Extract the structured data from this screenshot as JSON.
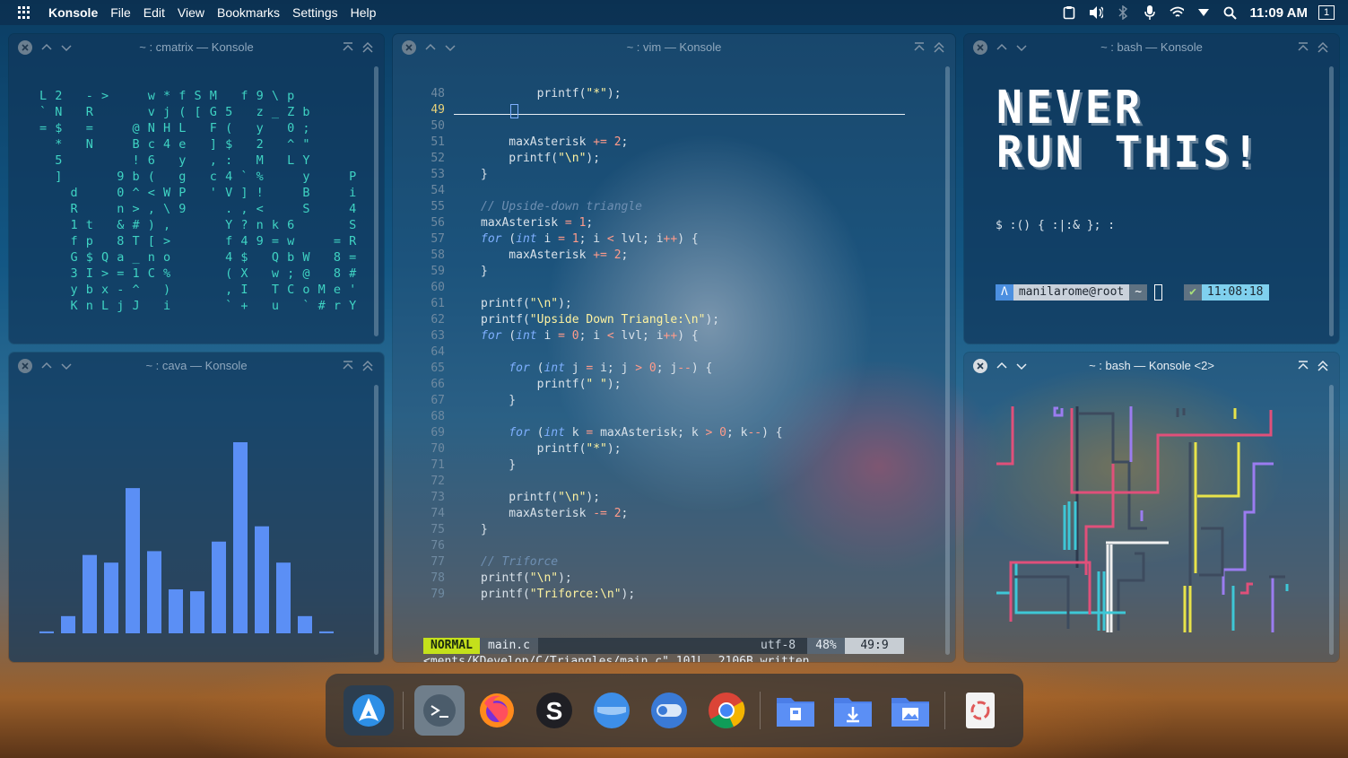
{
  "menubar": {
    "app": "Konsole",
    "items": [
      "File",
      "Edit",
      "View",
      "Bookmarks",
      "Settings",
      "Help"
    ],
    "clock": "11:09 AM",
    "desktop": "1"
  },
  "windows": {
    "cmatrix": {
      "title": "~ : cmatrix — Konsole",
      "lines": [
        "L 2   - >     w * f S M   f 9 \\ p",
        "` N   R       v j ( [ G 5   z _ Z b",
        "= $   =     @ N H L   F (   y   0 ;",
        "  *   N     B c 4 e   ] $   2   ^ \"",
        "  5         ! 6   y   , :   M   L Y",
        "  ]       9 b (   g   c 4 ` %     y     P",
        "    d     0 ^ < W P   ' V ] !     B     i",
        "    R     n > , \\ 9     . , <     S     4",
        "    1 t   & # ) ,       Y ? n k 6       S",
        "    f p   8 T [ >       f 4 9 = w     = R",
        "    G $ Q a _ n o       4 $   Q b W   8 =",
        "    3 I > = 1 C %       ( X   w ; @   8 #",
        "    y b x - ^   )       , I   T C o M e '",
        "    K n L j J   i       ` +   u   ` # r Y"
      ]
    },
    "cava": {
      "title": "~ : cava — Konsole",
      "bars": [
        0.01,
        0.09,
        0.41,
        0.37,
        0.76,
        0.43,
        0.23,
        0.22,
        0.48,
        1.0,
        0.56,
        0.37,
        0.09,
        0.01
      ]
    },
    "vim": {
      "title": "~ : vim — Konsole",
      "lines": [
        {
          "n": "48",
          "html": "        printf(<span class=\"str\">\"*\"</span>);"
        },
        {
          "n": "49",
          "html": "",
          "current": true
        },
        {
          "n": "50",
          "html": ""
        },
        {
          "n": "51",
          "html": "    maxAsterisk <span class=\"op\">+=</span> <span class=\"num\">2</span>;"
        },
        {
          "n": "52",
          "html": "    printf(<span class=\"str\">\"\\n\"</span>);"
        },
        {
          "n": "53",
          "html": "}"
        },
        {
          "n": "54",
          "html": ""
        },
        {
          "n": "55",
          "html": "<span class=\"cm\">// Upside-down triangle</span>"
        },
        {
          "n": "56",
          "html": "maxAsterisk <span class=\"op\">=</span> <span class=\"num\">1</span>;"
        },
        {
          "n": "57",
          "html": "<span class=\"kw\">for</span> (<span class=\"ty\">int</span> i <span class=\"op\">=</span> <span class=\"num\">1</span>; i <span class=\"op\">&lt;</span> lvl; i<span class=\"op\">++</span>) {"
        },
        {
          "n": "58",
          "html": "    maxAsterisk <span class=\"op\">+=</span> <span class=\"num\">2</span>;"
        },
        {
          "n": "59",
          "html": "}"
        },
        {
          "n": "60",
          "html": ""
        },
        {
          "n": "61",
          "html": "printf(<span class=\"str\">\"\\n\"</span>);"
        },
        {
          "n": "62",
          "html": "printf(<span class=\"str\">\"Upside Down Triangle:\\n\"</span>);"
        },
        {
          "n": "63",
          "html": "<span class=\"kw\">for</span> (<span class=\"ty\">int</span> i <span class=\"op\">=</span> <span class=\"num\">0</span>; i <span class=\"op\">&lt;</span> lvl; i<span class=\"op\">++</span>) {"
        },
        {
          "n": "64",
          "html": ""
        },
        {
          "n": "65",
          "html": "    <span class=\"kw\">for</span> (<span class=\"ty\">int</span> j <span class=\"op\">=</span> i; j <span class=\"op\">&gt;</span> <span class=\"num\">0</span>; j<span class=\"op\">--</span>) {"
        },
        {
          "n": "66",
          "html": "        printf(<span class=\"str\">\" \"</span>);"
        },
        {
          "n": "67",
          "html": "    }"
        },
        {
          "n": "68",
          "html": ""
        },
        {
          "n": "69",
          "html": "    <span class=\"kw\">for</span> (<span class=\"ty\">int</span> k <span class=\"op\">=</span> maxAsterisk; k <span class=\"op\">&gt;</span> <span class=\"num\">0</span>; k<span class=\"op\">--</span>) {"
        },
        {
          "n": "70",
          "html": "        printf(<span class=\"str\">\"*\"</span>);"
        },
        {
          "n": "71",
          "html": "    }"
        },
        {
          "n": "72",
          "html": ""
        },
        {
          "n": "73",
          "html": "    printf(<span class=\"str\">\"\\n\"</span>);"
        },
        {
          "n": "74",
          "html": "    maxAsterisk <span class=\"op\">-=</span> <span class=\"num\">2</span>;"
        },
        {
          "n": "75",
          "html": "}"
        },
        {
          "n": "76",
          "html": ""
        },
        {
          "n": "77",
          "html": "<span class=\"cm\">// Triforce</span>"
        },
        {
          "n": "78",
          "html": "printf(<span class=\"str\">\"\\n\"</span>);"
        },
        {
          "n": "79",
          "html": "printf(<span class=\"str\">\"Triforce:\\n\"</span>);"
        }
      ],
      "status": {
        "mode": "NORMAL",
        "file": "main.c",
        "encoding": "utf-8",
        "percent": "48%",
        "position": "49:9"
      },
      "message": "<ments/KDevelop/C/Triangles/main.c\" 101L, 2106B written"
    },
    "bash1": {
      "title": "~ : bash — Konsole",
      "banner_line1": "NEVER",
      "banner_line2": "RUN THIS!",
      "command": "$ :() { :|:& }; :",
      "prompt_user": "manilarome@root",
      "prompt_dir": "~",
      "prompt_check": "✔",
      "prompt_time": "11:08:18"
    },
    "bash2": {
      "title": "~ : bash — Konsole <2>"
    }
  },
  "dock": {
    "apps": [
      "arch-launcher",
      "terminal",
      "firefox",
      "sublime-text",
      "files",
      "settings-toggle",
      "chrome",
      "folder-documents",
      "folder-downloads",
      "folder-pictures",
      "trash"
    ]
  },
  "colors": {
    "matrix": "#3fd3c3",
    "cava": "#5b8ff5",
    "vim_mode": "#c4e01b",
    "prompt_user_bg": "#c9d1db",
    "prompt_arch_bg": "#4b8fe0",
    "prompt_time_bg": "#7fd0ee"
  }
}
